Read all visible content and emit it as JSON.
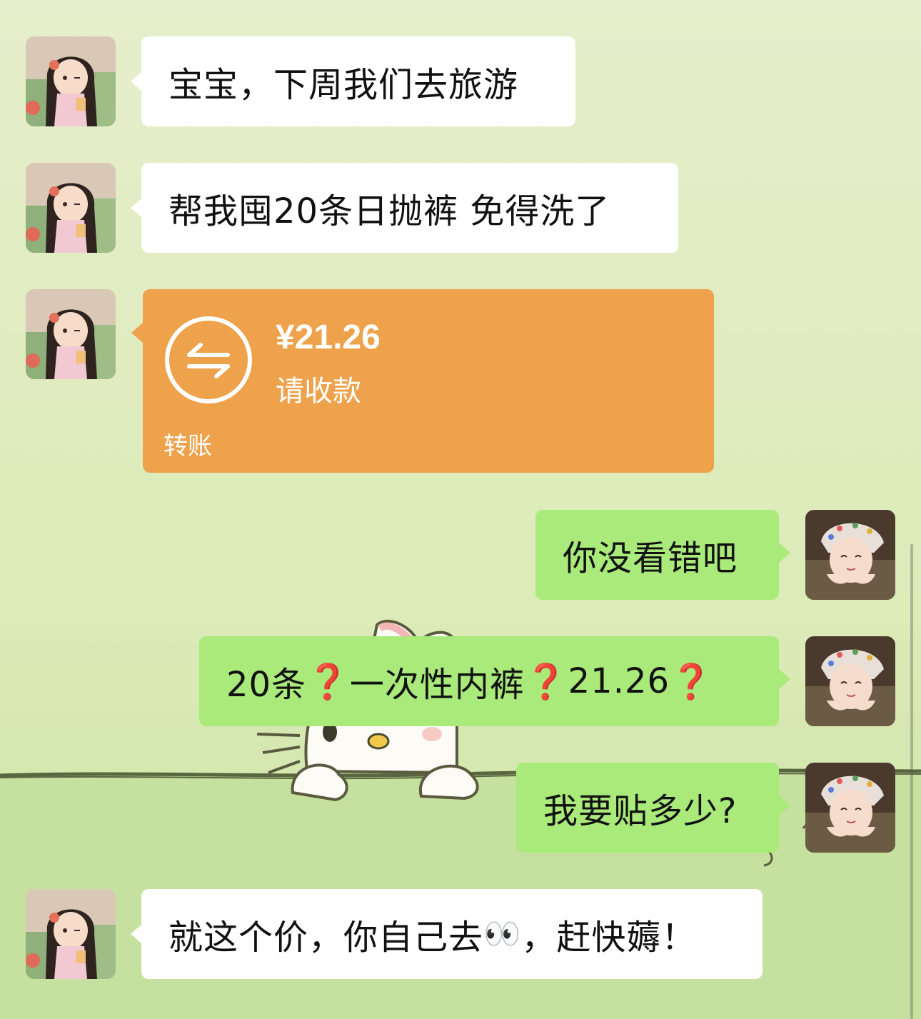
{
  "messages": [
    {
      "side": "left",
      "type": "text",
      "text": "宝宝，下周我们去旅游"
    },
    {
      "side": "left",
      "type": "text",
      "text": "帮我囤20条日抛裤 免得洗了"
    },
    {
      "side": "left",
      "type": "transfer",
      "amount": "¥21.26",
      "subtitle": "请收款",
      "footer": "转账"
    },
    {
      "side": "right",
      "type": "text",
      "text": "你没看错吧"
    },
    {
      "side": "right",
      "type": "mixed",
      "parts": [
        "20条",
        "❓",
        "一次性内裤",
        "❓",
        "21.26",
        "❓"
      ]
    },
    {
      "side": "right",
      "type": "text",
      "text": "我要贴多少?"
    },
    {
      "side": "left",
      "type": "mixed",
      "parts": [
        "就这个价，你自己去",
        "👀",
        "，赶快薅！"
      ]
    }
  ],
  "icons": {
    "transfer": "transfer-arrows-icon",
    "question": "red-question-mark-icon",
    "eyes": "eyes-emoji-icon"
  },
  "colors": {
    "left_bubble": "#ffffff",
    "right_bubble": "#a9ea7a",
    "transfer_card": "#eea24c",
    "question_mark": "#e2313f",
    "background": "#dcebb8"
  }
}
